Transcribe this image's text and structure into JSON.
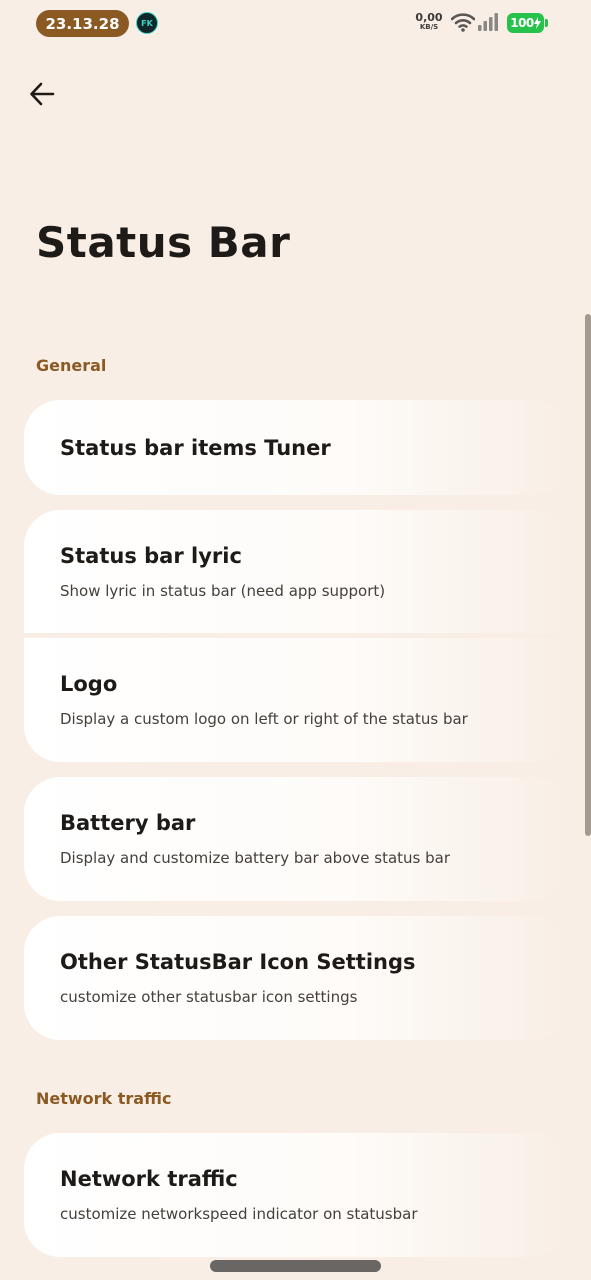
{
  "status_bar": {
    "time": "23.13.28",
    "app_icon_text": "FK",
    "net_speed_value": "0,00",
    "net_speed_unit": "KB/S",
    "battery_level": "100",
    "battery_color": "#27c24c"
  },
  "header": {
    "back_icon": "arrow-left-icon",
    "title": "Status Bar"
  },
  "sections": [
    {
      "header": "General",
      "items": [
        {
          "title": "Status bar items Tuner"
        },
        {
          "title": "Status bar lyric",
          "subtitle": "Show lyric in status bar (need app support)"
        },
        {
          "title": "Logo",
          "subtitle": "Display a custom logo on left or right of the status bar"
        },
        {
          "title": "Battery bar",
          "subtitle": "Display and customize battery bar above status bar"
        },
        {
          "title": "Other StatusBar Icon Settings",
          "subtitle": "customize other statusbar icon settings"
        }
      ]
    },
    {
      "header": "Network traffic",
      "items": [
        {
          "title": "Network traffic",
          "subtitle": "customize networkspeed indicator on statusbar"
        }
      ]
    }
  ],
  "colors": {
    "background": "#f8eee6",
    "accent": "#8b5a23",
    "card": "#ffffff"
  }
}
